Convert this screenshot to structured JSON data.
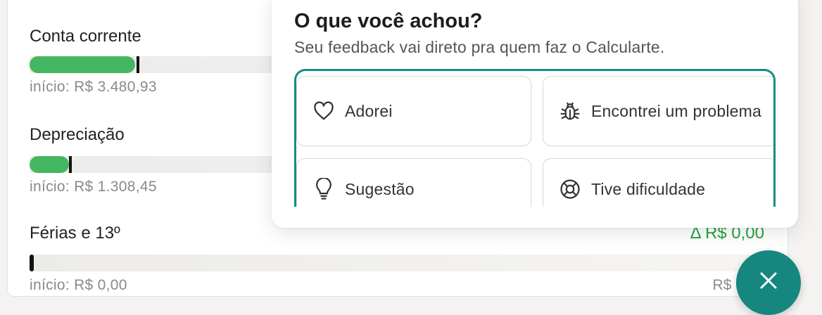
{
  "accounts": [
    {
      "title": "Conta corrente",
      "start": "início: R$ 3.480,93",
      "progress": 0.144
    },
    {
      "title": "Depreciação",
      "start": "início: R$ 1.308,45",
      "progress": 0.054
    },
    {
      "title": "Férias e 13º",
      "start": "início: R$ 0,00",
      "delta": "Δ R$ 0,00",
      "end": "R$ 0,00",
      "progress": 0.0
    }
  ],
  "feedback": {
    "title": "O que você achou?",
    "subtitle": "Seu feedback vai direto pra quem faz o Calcularte.",
    "options": [
      {
        "label": "Adorei",
        "icon": "heart-icon"
      },
      {
        "label": "Encontrei um problema",
        "icon": "bug-icon"
      },
      {
        "label": "Sugestão",
        "icon": "lightbulb-icon"
      },
      {
        "label": "Tive dificuldade",
        "icon": "lifebuoy-icon"
      }
    ],
    "accent_color": "#178c84"
  },
  "fab": {
    "icon": "close-icon",
    "color": "#16877f"
  },
  "colors": {
    "positive": "#25a244",
    "bar_fill": "#45b763"
  }
}
